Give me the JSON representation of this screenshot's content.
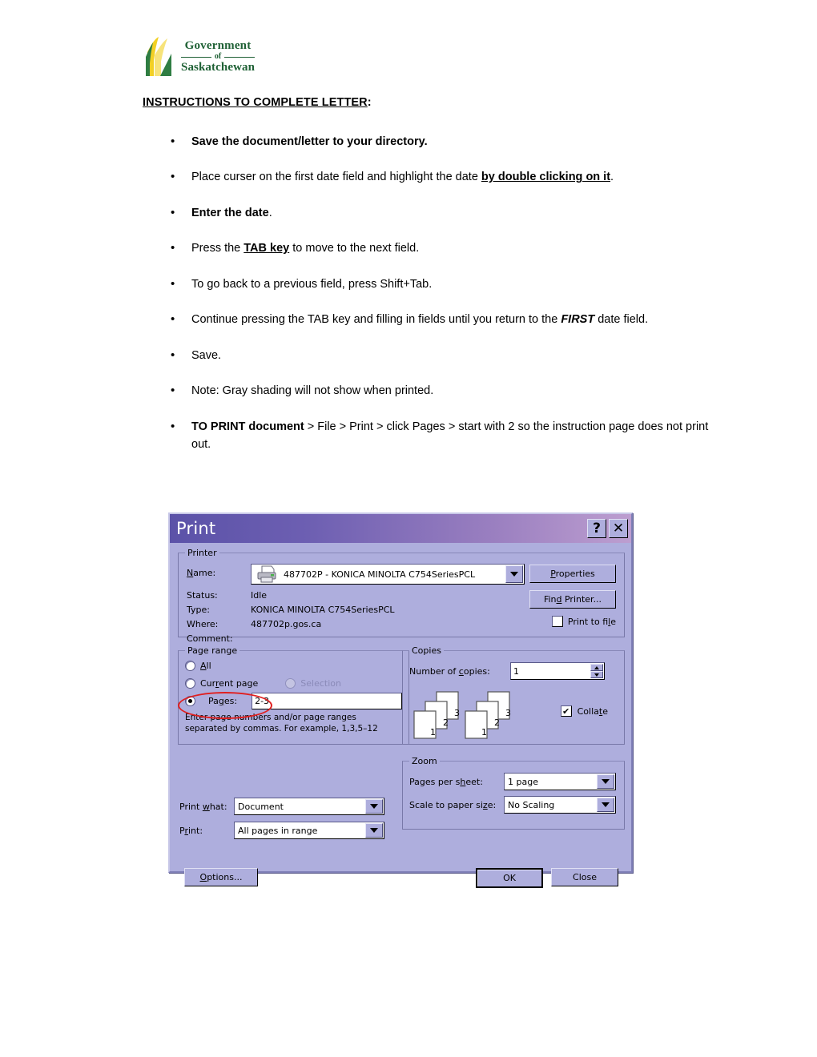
{
  "document": {
    "logo": {
      "line1": "Government",
      "line2": "of",
      "line3": "Saskatchewan",
      "brand_color": "#1f6135",
      "accent_color": "#f2d024",
      "icon": "saskatchewan-wheat-logo"
    },
    "heading": "INSTRUCTIONS TO COMPLETE LETTER",
    "heading_colon": ":",
    "bullets": [
      {
        "id": "save-directory",
        "parts": [
          {
            "text": "Save the document/letter to your directory.",
            "style": "bold"
          }
        ]
      },
      {
        "id": "place-curser",
        "parts": [
          {
            "text": "Place curser on the first date field and highlight the date ",
            "style": "normal"
          },
          {
            "text": "by double clicking on it",
            "style": "bold-underline"
          },
          {
            "text": ".",
            "style": "normal"
          }
        ]
      },
      {
        "id": "enter-date",
        "parts": [
          {
            "text": "Enter the date",
            "style": "bold"
          },
          {
            "text": ".",
            "style": "normal"
          }
        ]
      },
      {
        "id": "press-tab",
        "parts": [
          {
            "text": "Press the ",
            "style": "normal"
          },
          {
            "text": "TAB key",
            "style": "bold-underline"
          },
          {
            "text": " to move to the next field.",
            "style": "normal"
          }
        ]
      },
      {
        "id": "shift-tab",
        "parts": [
          {
            "text": "To go back to a previous field, press Shift+Tab.",
            "style": "normal"
          }
        ]
      },
      {
        "id": "continue-tab",
        "parts": [
          {
            "text": "Continue pressing the TAB key and filling in fields until you return to the ",
            "style": "normal"
          },
          {
            "text": "FIRST",
            "style": "bold-italic"
          },
          {
            "text": " date field.",
            "style": "normal"
          }
        ]
      },
      {
        "id": "save",
        "parts": [
          {
            "text": "Save.",
            "style": "normal"
          }
        ]
      },
      {
        "id": "note-gray",
        "parts": [
          {
            "text": "Note:  Gray shading will not show when printed.",
            "style": "normal"
          }
        ]
      },
      {
        "id": "to-print",
        "parts": [
          {
            "text": "TO PRINT document",
            "style": "bold"
          },
          {
            "text": " > File > Print > click Pages > start with 2 so the instruction page does not print out.",
            "style": "normal"
          }
        ]
      }
    ]
  },
  "print_dialog": {
    "title": "Print",
    "help_button": "?",
    "close_button": "✕",
    "printer": {
      "legend": "Printer",
      "name_label": "Name:",
      "name_mnemonic": "N",
      "name_value": "487702P - KONICA MINOLTA C754SeriesPCL",
      "status_label": "Status:",
      "status_value": "Idle",
      "type_label": "Type:",
      "type_value": "KONICA MINOLTA C754SeriesPCL",
      "where_label": "Where:",
      "where_value": "487702p.gos.ca",
      "comment_label": "Comment:",
      "comment_value": "",
      "properties_button": "Properties",
      "find_printer_button": "Find Printer...",
      "print_to_file_label": "Print to file",
      "print_to_file_checked": false
    },
    "page_range": {
      "legend": "Page range",
      "option_all": "All",
      "option_current_page": "Current page",
      "option_selection": "Selection",
      "selection_disabled": true,
      "option_pages": "Pages:",
      "selected_option": "Pages",
      "pages_value": "2-3",
      "hint_line1": "Enter page numbers and/or page ranges",
      "hint_line2": "separated by commas.  For example, 1,3,5–12"
    },
    "copies": {
      "legend": "Copies",
      "number_label": "Number of copies:",
      "number_value": "1",
      "collate_label": "Collate",
      "collate_checked": true,
      "collate_check_glyph": "✔",
      "page_numbers": [
        "3",
        "2",
        "1"
      ]
    },
    "print_what": {
      "label": "Print what:",
      "value": "Document"
    },
    "print_subset": {
      "label": "Print:",
      "value": "All pages in range"
    },
    "zoom": {
      "legend": "Zoom",
      "pages_per_sheet_label": "Pages per sheet:",
      "pages_per_sheet_value": "1 page",
      "scale_label": "Scale to paper size:",
      "scale_value": "No Scaling"
    },
    "footer": {
      "options_button": "Options...",
      "ok_button": "OK",
      "close_button": "Close"
    },
    "annotation": {
      "shape": "red-ellipse",
      "color": "#e02020",
      "target": "pages-radio-and-input"
    },
    "colors": {
      "dialog_background": "#aeaedd",
      "titlebar_start": "#5b52a8",
      "titlebar_end": "#bd9ed0"
    }
  }
}
